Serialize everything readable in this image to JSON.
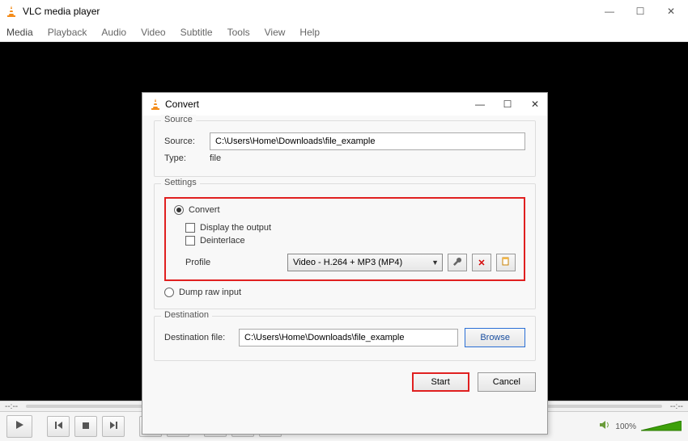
{
  "main": {
    "title": "VLC media player",
    "menus": [
      "Media",
      "Playback",
      "Audio",
      "Video",
      "Subtitle",
      "Tools",
      "View",
      "Help"
    ],
    "timeline": {
      "left": "--:--",
      "right": "--:--"
    },
    "volume": {
      "label": "100%"
    }
  },
  "dialog": {
    "title": "Convert",
    "source": {
      "group_label": "Source",
      "source_label": "Source:",
      "source_value": "C:\\Users\\Home\\Downloads\\file_example",
      "type_label": "Type:",
      "type_value": "file"
    },
    "settings": {
      "group_label": "Settings",
      "convert_label": "Convert",
      "display_output_label": "Display the output",
      "deinterlace_label": "Deinterlace",
      "profile_label": "Profile",
      "profile_value": "Video - H.264 + MP3 (MP4)",
      "dump_raw_label": "Dump raw input"
    },
    "destination": {
      "group_label": "Destination",
      "label": "Destination file:",
      "value": "C:\\Users\\Home\\Downloads\\file_example",
      "browse_label": "Browse"
    },
    "buttons": {
      "start": "Start",
      "cancel": "Cancel"
    }
  }
}
